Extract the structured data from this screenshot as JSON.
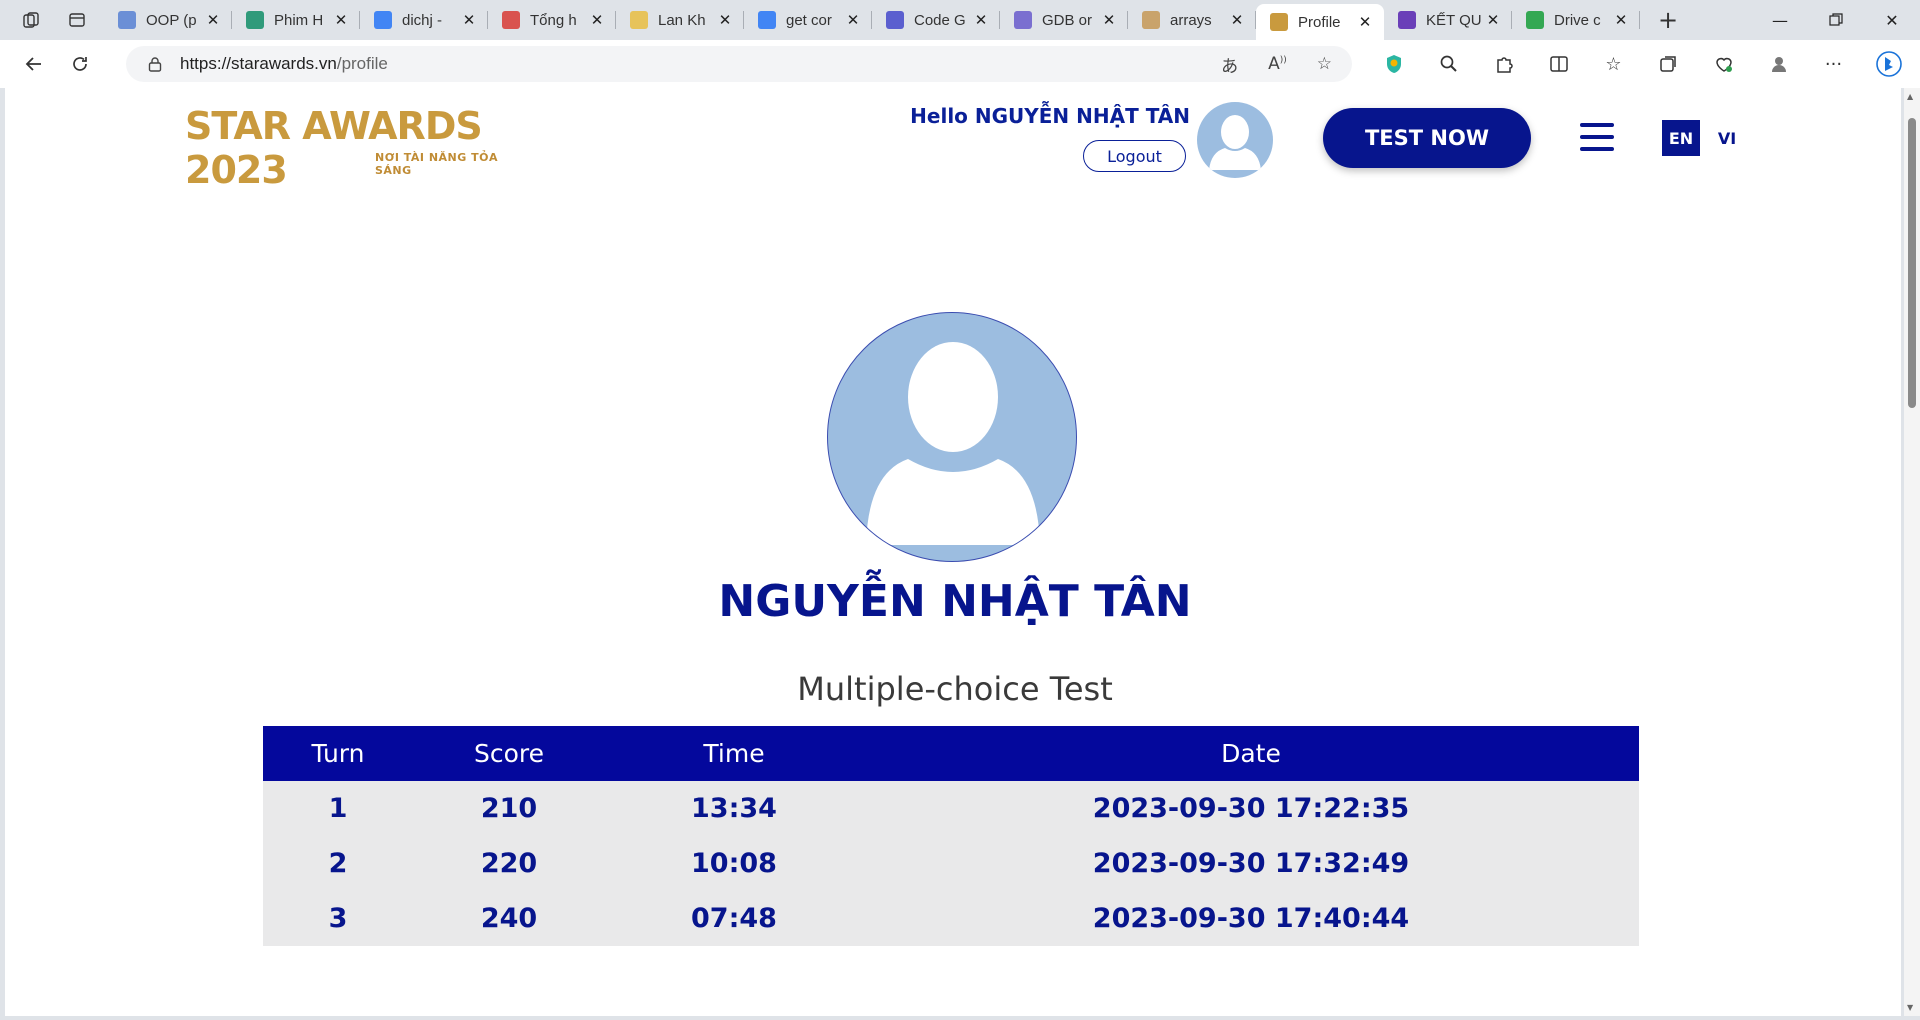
{
  "browser": {
    "tabs": [
      {
        "title": "OOP (p",
        "icon": "recycle-icon",
        "color": "#6b8fd6"
      },
      {
        "title": "Phim H",
        "icon": "chatgpt-icon",
        "color": "#2f9a7a"
      },
      {
        "title": "dichj -",
        "icon": "google-icon",
        "color": "#4285f4"
      },
      {
        "title": "Tổng h",
        "icon": "t-icon",
        "color": "#d9534f"
      },
      {
        "title": "Lan Kh",
        "icon": "n-icon",
        "color": "#e7c35a"
      },
      {
        "title": "get cor",
        "icon": "google-icon",
        "color": "#4285f4"
      },
      {
        "title": "Code G",
        "icon": "robot-icon",
        "color": "#5b5fcf"
      },
      {
        "title": "GDB or",
        "icon": "bolt-icon",
        "color": "#7a6fd0"
      },
      {
        "title": "arrays",
        "icon": "leaf-icon",
        "color": "#c9a36b"
      },
      {
        "title": "Profile",
        "icon": "star-icon",
        "color": "#c99a3e",
        "active": true
      },
      {
        "title": "KẾT QU",
        "icon": "form-icon",
        "color": "#6a3fb8"
      },
      {
        "title": "Drive c",
        "icon": "drive-icon",
        "color": "#34a853"
      }
    ],
    "url_host": "https://starawards.vn",
    "url_path": "/profile"
  },
  "header": {
    "logo_main": "STAR AWARDS 2023",
    "logo_sub": "NƠI TÀI NĂNG TỎA SÁNG",
    "greeting": "Hello NGUYỄN NHẬT TÂN",
    "logout_label": "Logout",
    "test_now_label": "TEST NOW",
    "lang_en": "EN",
    "lang_vi": "VI"
  },
  "profile": {
    "name": "NGUYỄN NHẬT TÂN",
    "section_title": "Multiple-choice Test"
  },
  "results": {
    "headers": {
      "turn": "Turn",
      "score": "Score",
      "time": "Time",
      "date": "Date"
    },
    "rows": [
      {
        "turn": "1",
        "score": "210",
        "time": "13:34",
        "date": "2023-09-30 17:22:35"
      },
      {
        "turn": "2",
        "score": "220",
        "time": "10:08",
        "date": "2023-09-30 17:32:49"
      },
      {
        "turn": "3",
        "score": "240",
        "time": "07:48",
        "date": "2023-09-30 17:40:44"
      }
    ]
  },
  "colors": {
    "brand_navy": "#07158d",
    "table_header": "#04089c",
    "row_bg": "#e9e9ea",
    "logo_gold": "#c99a3e",
    "avatar_blue": "#9cbde0"
  }
}
